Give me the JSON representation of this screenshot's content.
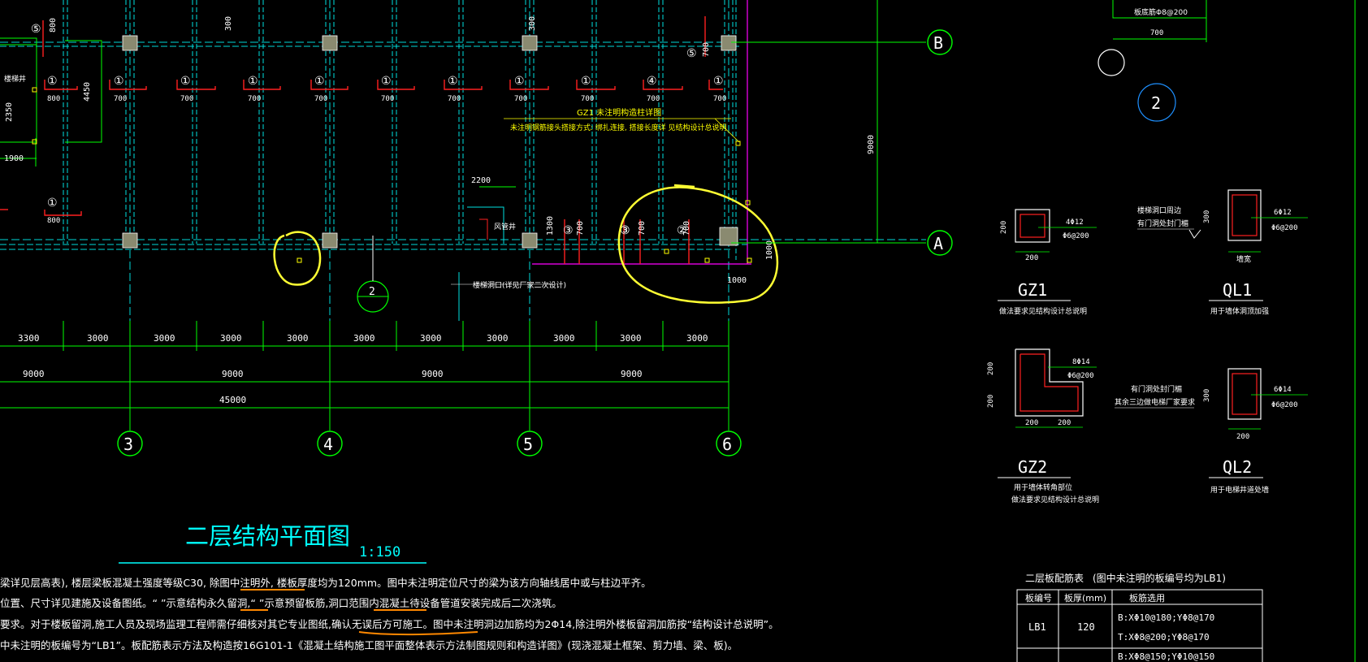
{
  "colors": {
    "background": "#000000",
    "axis_grid": "#00d8d8",
    "dimension": "#00ff00",
    "text": "#ffffff",
    "beam": "#00e0e0",
    "slab_rebar": "#ff2020",
    "highlight": "#ffff00",
    "markup_circle": "#ffff33",
    "boundary": "#ff00ff",
    "underline": "#ff8800",
    "title": "#00ffff"
  },
  "axes": {
    "labels": [
      "B",
      "A",
      "3",
      "4",
      "5",
      "6"
    ],
    "detail_markers": [
      "2",
      "2"
    ]
  },
  "dimensions": {
    "spacing_3000": "3000",
    "first_3300": "3300",
    "span_9000": "9000",
    "total_45000": "45000",
    "height_9000": "9000",
    "top_300": "300",
    "opening_2200": "2200",
    "d_1300": "1300",
    "d_700": "700",
    "d_800": "800",
    "d_1000": "1000",
    "d_1900": "1900",
    "d_4450": "4450",
    "d_2350": "2350"
  },
  "rebar_tags": {
    "t1": "①",
    "t2": "②",
    "t3": "③",
    "t4": "④",
    "t5": "⑤"
  },
  "notes": {
    "gz1_note": "GZ1 未注明构造柱详图",
    "beam_note": "未注明钢筋接头搭接方式: 绑扎连接, 搭接长度详 见结构设计总说明",
    "stair_note": "楼梯洞口(详见厂家二次设计)",
    "left_note": "楼梯井",
    "ventilation": "风管井",
    "top_right_rebar": "板底筋Φ8@200"
  },
  "details": {
    "gz1": {
      "name": "GZ1",
      "bars": "4Φ12",
      "stirrup": "Φ6@200",
      "dim": "200",
      "caption": "做法要求见结构设计总说明"
    },
    "ql1": {
      "name": "QL1",
      "bars": "6Φ12",
      "stirrup": "Φ6@200",
      "dim": "300",
      "caption": "用于墙体洞顶加强",
      "side_note_1": "楼梯洞口周边",
      "side_note_2": "有门洞处封门楣",
      "bottom": "墙宽"
    },
    "gz2": {
      "name": "GZ2",
      "bars": "8Φ14",
      "stirrup": "Φ6@200",
      "dim_a": "200",
      "dim_b": "200",
      "caption_1": "用于墙体转角部位",
      "caption_2": "做法要求见结构设计总说明"
    },
    "ql2": {
      "name": "QL2",
      "bars": "6Φ14",
      "stirrup": "Φ6@200",
      "dim": "300",
      "caption": "用于电梯井道处墙",
      "side_note_1": "有门洞处封门楣",
      "side_note_2": "其余三边做电梯厂家要求",
      "bottom": "200"
    }
  },
  "drawing_title": {
    "title": "二层结构平面图",
    "scale": "1:150"
  },
  "general_notes": [
    "梁详见层高表), 楼层梁板混凝土强度等级C30, 除图中注明外, 楼板厚度均为120mm。图中未注明定位尺寸的梁为该方向轴线居中或与柱边平齐。",
    "位置、尺寸详见建施及设备图纸。“      ”示意结构永久留洞,“      ”示意预留板筋,洞口范围内混凝土待设备管道安装完成后二次浇筑。",
    "要求。对于楼板留洞,施工人员及现场监理工程师需仔细核对其它专业图纸,确认无误后方可施工。图中未注明洞边加筋均为2Φ14,除注明外楼板留洞加筋按“结构设计总说明”。",
    "中未注明的板编号为“LB1”。板配筋表示方法及构造按16G101-1《混凝土结构施工图平面整体表示方法制图规则和构造详图》(现浇混凝土框架、剪力墙、梁、板)。"
  ],
  "slab_table": {
    "title": "二层板配筋表",
    "subtitle": "(图中未注明的板编号均为LB1)",
    "headers": [
      "板编号",
      "板厚(mm)",
      "板筋选用"
    ],
    "rows": [
      {
        "id": "LB1",
        "thickness": "120",
        "rebar_1": "B:XΦ10@180;YΦ8@170",
        "rebar_2": "T:XΦ8@200;YΦ8@170"
      },
      {
        "id": "",
        "thickness": "",
        "rebar_1": "B:XΦ8@150;YΦ10@150",
        "rebar_2": ""
      }
    ]
  }
}
